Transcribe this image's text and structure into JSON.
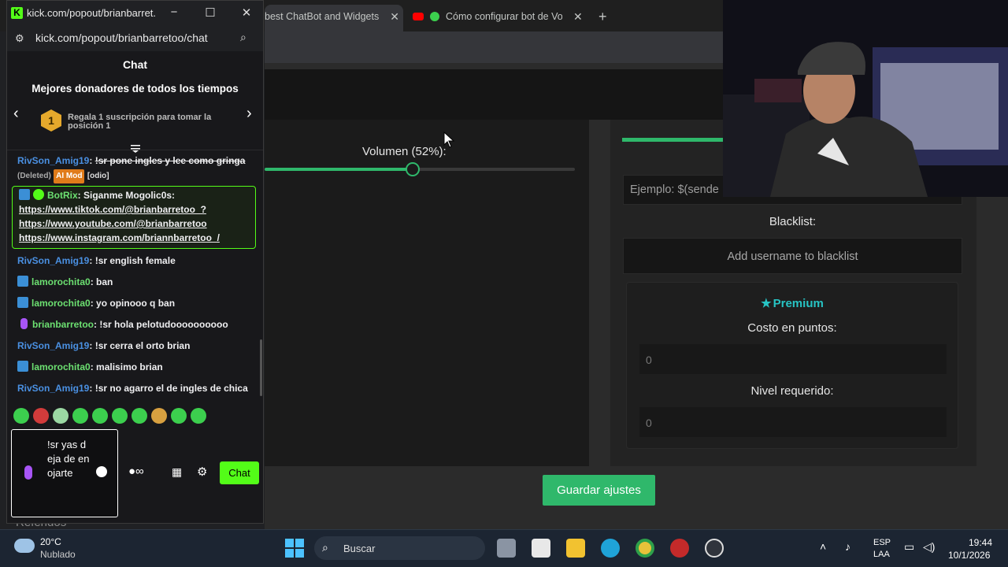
{
  "browser": {
    "tabs": [
      {
        "label": "best ChatBot and Widgets"
      },
      {
        "label": "Cómo configurar bot de Vo"
      }
    ],
    "new_tab": "+"
  },
  "settings": {
    "volume_label": "Volumen (52%):",
    "volume_value": 0.52,
    "example_placeholder": "Ejemplo: $(sende",
    "blacklist_label": "Blacklist:",
    "blacklist_placeholder": "Add username to blacklist",
    "premium_title": "Premium",
    "cost_label": "Costo en puntos:",
    "cost_value": "0",
    "level_label": "Nivel requerido:",
    "level_value": "0",
    "save_label": "Guardar ajustes",
    "referidos": "Referidos"
  },
  "popout": {
    "title": "kick.com/popout/brianbarret...",
    "url": "kick.com/popout/brianbarretoo/chat",
    "chat_header": "Chat",
    "donors_title": "Mejores donadores de todos los tiempos",
    "rank": "1",
    "gift_text": "Regala 1 suscripción para tomar la posición 1"
  },
  "messages": [
    {
      "user": "RivSon_Amig19",
      "text": "!sr pone ingles y lee como gringa",
      "deleted": "(Deleted)",
      "tag": "AI Mod",
      "reason": "[odio]"
    },
    {
      "user": "BotRix",
      "text": "Siganme Mogolic0s:",
      "links": [
        "https://www.tiktok.com/@brianbarretoo_?",
        "https://www.youtube.com/@brianbarretoo",
        "https://www.instagram.com/briannbarretoo_/"
      ]
    },
    {
      "user": "RivSon_Amig19",
      "text": "!sr english female"
    },
    {
      "user": "lamorochita0",
      "text": "ban"
    },
    {
      "user": "lamorochita0",
      "text": "yo opinooo q ban"
    },
    {
      "user": "brianbarretoo",
      "text": "!sr hola pelotudoooooooooo"
    },
    {
      "user": "RivSon_Amig19",
      "text": "!sr cerra el orto brian"
    },
    {
      "user": "lamorochita0",
      "text": "malisimo brian"
    },
    {
      "user": "RivSon_Amig19",
      "text": "!sr no agarro el de ingles de chica"
    }
  ],
  "chat_input": {
    "value": "!sr yas deja de enojarte",
    "send_label": "Chat"
  },
  "taskbar": {
    "temperature": "20°C",
    "weather": "Nublado",
    "search_label": "Buscar",
    "lang1": "ESP",
    "lang2": "LAA",
    "time": "19:44",
    "date": "10/1/2026"
  },
  "colors": {
    "kick_green": "#53fc18",
    "accent_green": "#2fb86b",
    "premium": "#27c4c4",
    "ai_mod": "#e07b1a"
  }
}
